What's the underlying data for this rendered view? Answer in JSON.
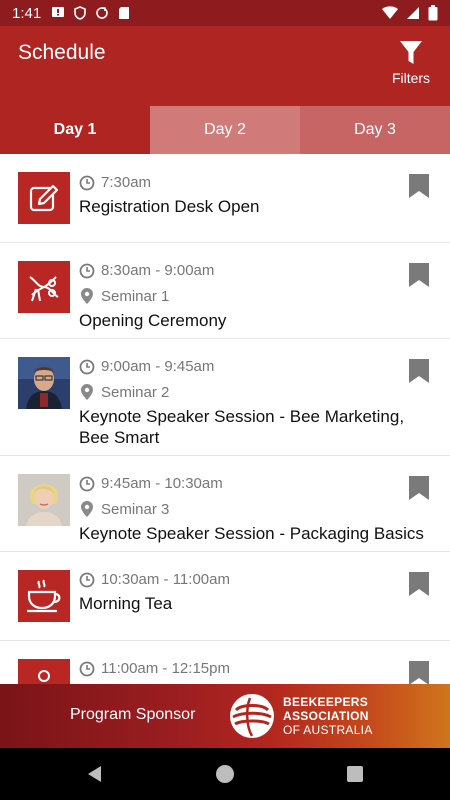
{
  "status_bar": {
    "time": "1:41",
    "left_icons": [
      "message-icon",
      "shield-icon",
      "sync-icon",
      "sd-card-icon"
    ],
    "right_icons": [
      "wifi-icon",
      "signal-icon",
      "battery-icon"
    ]
  },
  "app_bar": {
    "title": "Schedule",
    "filters_label": "Filters"
  },
  "tabs": [
    {
      "label": "Day 1",
      "active": true
    },
    {
      "label": "Day 2",
      "active": false
    },
    {
      "label": "Day 3",
      "active": false
    }
  ],
  "sessions": [
    {
      "time": "7:30am",
      "location": "",
      "title": "Registration Desk Open",
      "thumb": "pencil-edit-icon"
    },
    {
      "time": "8:30am - 9:00am",
      "location": "Seminar 1",
      "title": "Opening Ceremony",
      "thumb": "ribbon-scissors-icon"
    },
    {
      "time": "9:00am - 9:45am",
      "location": "Seminar 2",
      "title": "Keynote Speaker Session - Bee Marketing, Bee Smart",
      "thumb": "speaker-photo-man"
    },
    {
      "time": "9:45am - 10:30am",
      "location": "Seminar 3",
      "title": "Keynote Speaker Session - Packaging Basics",
      "thumb": "speaker-photo-woman"
    },
    {
      "time": "10:30am - 11:00am",
      "location": "",
      "title": "Morning Tea",
      "thumb": "tea-cup-icon"
    },
    {
      "time": "11:00am - 12:15pm",
      "location": "",
      "title": "",
      "thumb": "presenter-icon"
    }
  ],
  "sponsor": {
    "label": "Program Sponsor",
    "org_line1": "BEEKEEPERS",
    "org_line2": "ASSOCIATION",
    "org_line3": "OF AUSTRALIA"
  },
  "colors": {
    "primary": "#ae2522",
    "status_bar": "#8e1c1f",
    "meta_text": "#777777",
    "bookmark": "#7a7a7a"
  }
}
